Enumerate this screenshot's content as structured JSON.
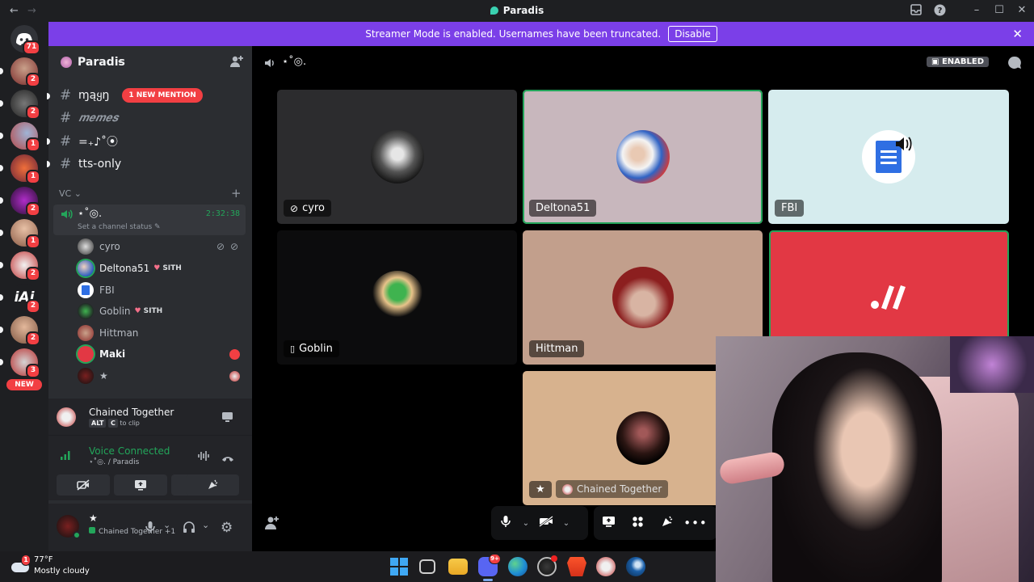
{
  "window": {
    "title": "Paradis",
    "back": "←",
    "forward": "→"
  },
  "banner": {
    "text": "Streamer Mode is enabled. Usernames have been truncated.",
    "disable_label": "Disable"
  },
  "guilds": {
    "home_badge": "71",
    "new_label": "NEW",
    "servers": [
      {
        "badge": "2"
      },
      {
        "badge": "2"
      },
      {
        "badge": "1"
      },
      {
        "badge": "1"
      },
      {
        "badge": "2"
      },
      {
        "badge": "1"
      },
      {
        "badge": "2"
      },
      {
        "badge": "2"
      },
      {
        "badge": "2"
      },
      {
        "badge": "3"
      }
    ]
  },
  "server": {
    "name": "Paradis"
  },
  "channels": [
    {
      "name": "ɱąყŋ",
      "mention": "1 NEW MENTION"
    },
    {
      "name": "𝒎𝒆𝒎𝒆𝒔"
    },
    {
      "name": "=₊♪˚⦿"
    },
    {
      "name": "tts-only"
    }
  ],
  "voice_category": {
    "name": "VC",
    "add": "+"
  },
  "voice_channel": {
    "name": "⋆˚◎.",
    "status_placeholder": "Set a channel status",
    "timer": "2:32:38"
  },
  "voice_users": [
    {
      "name": "cyro"
    },
    {
      "name": "Deltona51",
      "tag": "SITH"
    },
    {
      "name": "FBI"
    },
    {
      "name": "Goblin",
      "tag": "SITH"
    },
    {
      "name": "Hittman"
    },
    {
      "name": "Maki"
    },
    {
      "name": "★"
    }
  ],
  "activity": {
    "title": "Chained Together",
    "key1": "ALT",
    "key2": "C",
    "hint": "to clip"
  },
  "voice_status": {
    "label": "Voice Connected",
    "channel": "⋆˚◎. / Paradis"
  },
  "user_panel": {
    "name": "★",
    "status": "Chained Together +1"
  },
  "stage_header": {
    "channel": "⋆˚◎.",
    "enabled_label": "ENABLED"
  },
  "tiles": [
    {
      "name": "cyro"
    },
    {
      "name": "Deltona51"
    },
    {
      "name": "FBI"
    },
    {
      "name": "Goblin"
    },
    {
      "name": "Hittman"
    },
    {
      "name": "★"
    },
    {
      "name": "Chained Together"
    }
  ],
  "taskbar": {
    "temp": "77°F",
    "weather": "Mostly cloudy",
    "weather_badge": "1",
    "discord_badge": "9+"
  },
  "colors": {
    "blurple": "#7b3fe8",
    "green": "#23a55a",
    "red": "#f23f43",
    "maki": "#e23844"
  }
}
